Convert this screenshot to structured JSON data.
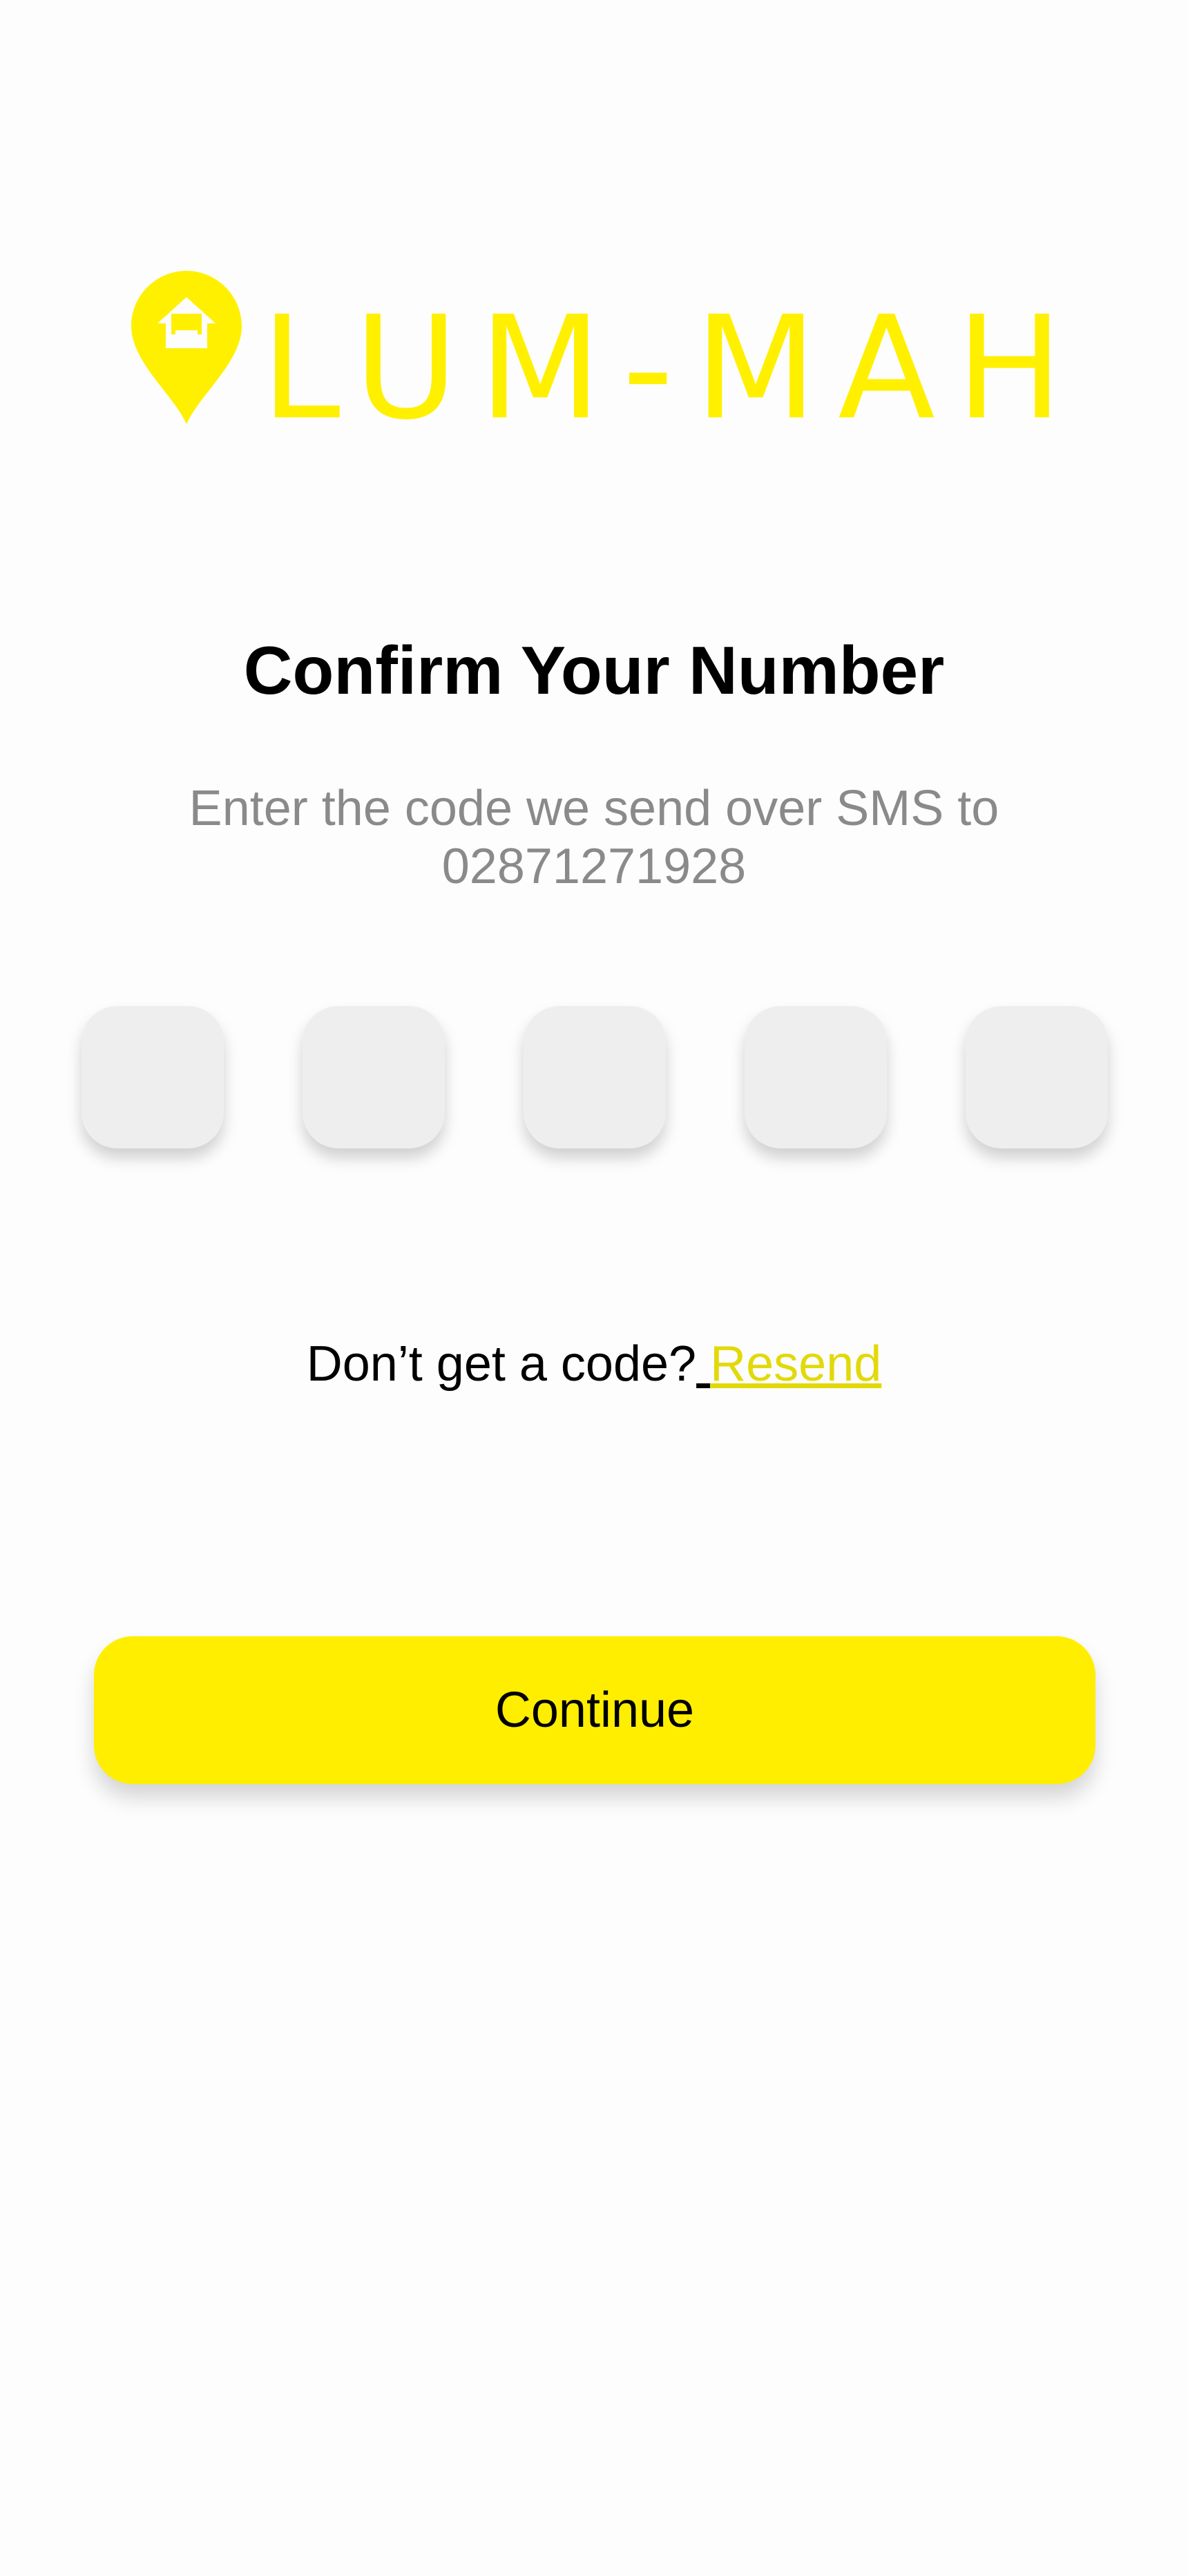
{
  "brand": {
    "name": "LUM-MAH",
    "logo_icon": "home-location-pin-icon",
    "color": "#fff000"
  },
  "content": {
    "title": "Confirm Your Number",
    "instruction_line1": "Enter the code we send over SMS to",
    "phone_number": "02871271928"
  },
  "code_inputs": {
    "count": 5,
    "values": [
      "",
      "",
      "",
      "",
      ""
    ]
  },
  "resend": {
    "prompt": "Don’t get a code?",
    "link_label": "Resend",
    "link_color": "#e2d90a"
  },
  "actions": {
    "continue_label": "Continue",
    "continue_color": "#ffee00"
  }
}
